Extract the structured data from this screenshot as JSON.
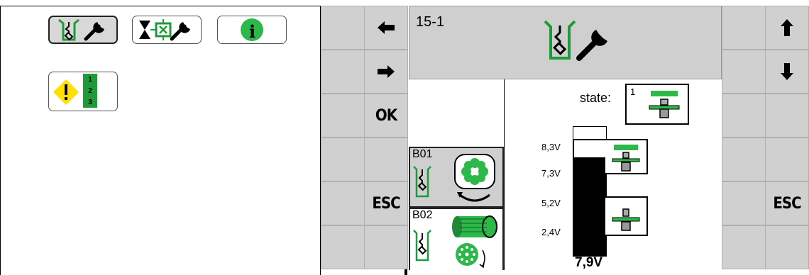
{
  "keys": {
    "left_arrow": "left-arrow",
    "right_arrow": "right-arrow",
    "ok": "OK",
    "esc_left": "ESC",
    "up_arrow": "up-arrow",
    "down_arrow": "down-arrow",
    "esc_right": "ESC"
  },
  "panel": {
    "page_id": "15-1",
    "header_icon": "sensor-wrench-icon",
    "state_label": "state:",
    "state_value": "1"
  },
  "sensors": [
    {
      "label": "B01",
      "icon": "fan-rotation-icon"
    },
    {
      "label": "B02",
      "icon": "roller-conveyor-icon"
    }
  ],
  "gauge": {
    "value_text": "7,9V",
    "value": 7.9,
    "ticks": [
      "8,3V",
      "7,3V",
      "5,2V",
      "2,4V"
    ]
  },
  "toolbar": {
    "items": [
      "sensor-wrench-icon",
      "valve-wrench-icon",
      "info-icon",
      "warning-list-icon"
    ],
    "info_glyph": "i",
    "list_numbers": [
      "1",
      "2",
      "3"
    ]
  },
  "colors": {
    "accent_green": "#1f9a3a",
    "bright_green": "#2db84a",
    "key_gray": "#d0d0d0",
    "header_gray": "#cfcfcf",
    "warning_yellow": "#ffe000"
  }
}
